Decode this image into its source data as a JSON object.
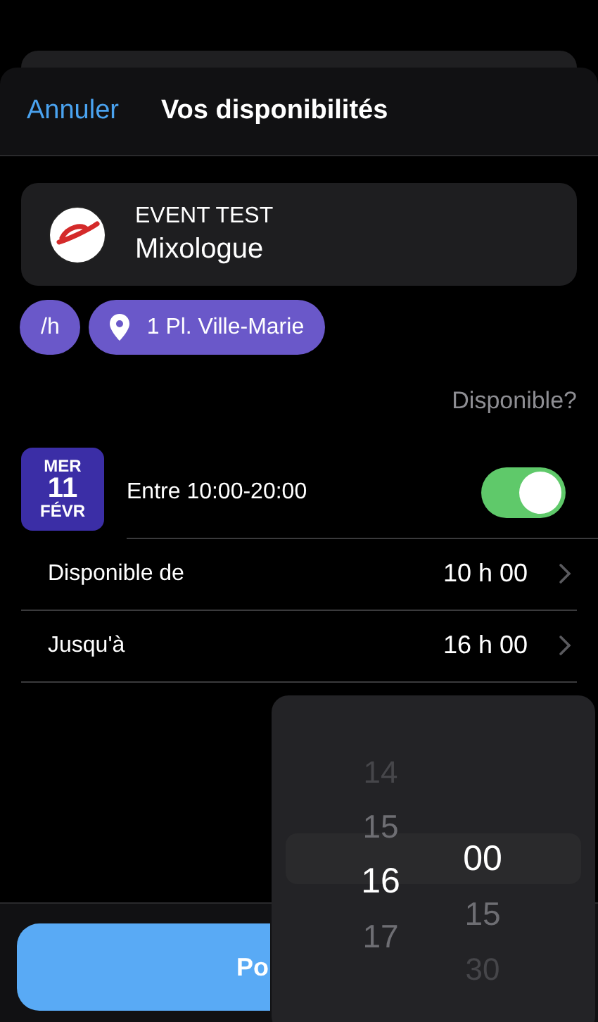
{
  "header": {
    "cancel": "Annuler",
    "title": "Vos disponibilités"
  },
  "event": {
    "name": "EVENT TEST",
    "role": "Mixologue"
  },
  "chips": [
    {
      "kind": "text",
      "label": "/h"
    },
    {
      "kind": "location",
      "label": "1 Pl. Ville-Marie"
    }
  ],
  "availability_heading": "Disponible?",
  "day": {
    "weekday": "MER",
    "day": "11",
    "month": "FÉVR",
    "range": "Entre 10:00-20:00",
    "on": true
  },
  "rows": [
    {
      "label": "Disponible de",
      "value": "10 h 00"
    },
    {
      "label": "Jusqu'à",
      "value": "16 h 00"
    }
  ],
  "submit_button": "Po",
  "picker": {
    "hours": [
      {
        "label": "14",
        "selected": false
      },
      {
        "label": "15",
        "selected": false
      },
      {
        "label": "16",
        "selected": true
      },
      {
        "label": "17",
        "selected": false
      }
    ],
    "minutes": [
      {
        "label": "00",
        "selected": true
      },
      {
        "label": "15",
        "selected": false
      },
      {
        "label": "30",
        "selected": false
      }
    ]
  }
}
